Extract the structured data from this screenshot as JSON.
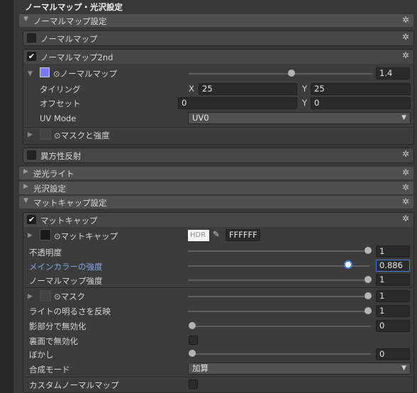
{
  "title": "ノーマルマップ・光沢設定",
  "sections": {
    "normal_map_settings": "ノーマルマップ設定",
    "backlight": "逆光ライト",
    "gloss": "光沢設定",
    "matcap_settings": "マットキャップ設定"
  },
  "normal_map": {
    "label": "ノーマルマップ",
    "checked": false
  },
  "normal_map_2nd": {
    "label": "ノーマルマップ2nd",
    "checked": true,
    "texture_label": "⊙ノーマルマップ",
    "texture_color": "#7b7bff",
    "strength_value": "1.4",
    "tiling_label": "タイリング",
    "tiling_x": "25",
    "tiling_y": "25",
    "offset_label": "オフセット",
    "offset_x": "0",
    "offset_y": "0",
    "x_axis": "X",
    "y_axis": "Y",
    "uv_mode_label": "UV Mode",
    "uv_mode_value": "UV0",
    "mask_label": "⊙マスクと強度"
  },
  "anisotropy": {
    "label": "異方性反射",
    "checked": false
  },
  "matcap": {
    "label": "マットキャップ",
    "checked": true,
    "texture_label": "⊙マットキャップ",
    "hdr_label": "HDR",
    "color_hex": "FFFFFF",
    "opacity_label": "不透明度",
    "opacity_value": "1",
    "main_color_strength_label": "メインカラーの強度",
    "main_color_strength_value": "0.886",
    "normal_strength_label": "ノーマルマップ強度",
    "normal_strength_value": "1",
    "mask_label": "⊙マスク",
    "mask_value": "1",
    "light_brightness_label": "ライトの明るさを反映",
    "light_brightness_value": "1",
    "shadow_disable_label": "影部分で無効化",
    "shadow_disable_value": "0",
    "backface_disable_label": "裏面で無効化",
    "blur_label": "ぼかし",
    "blur_value": "0",
    "blend_mode_label": "合成モード",
    "blend_mode_value": "加算",
    "custom_normal_label": "カスタムノーマルマップ"
  },
  "icons": {
    "gear": "gear-icon",
    "foldout": "triangle-icon",
    "picker": "eyedropper-icon"
  },
  "colors": {
    "accent": "#3b86e8",
    "highlight_text": "#7ea6ec"
  }
}
